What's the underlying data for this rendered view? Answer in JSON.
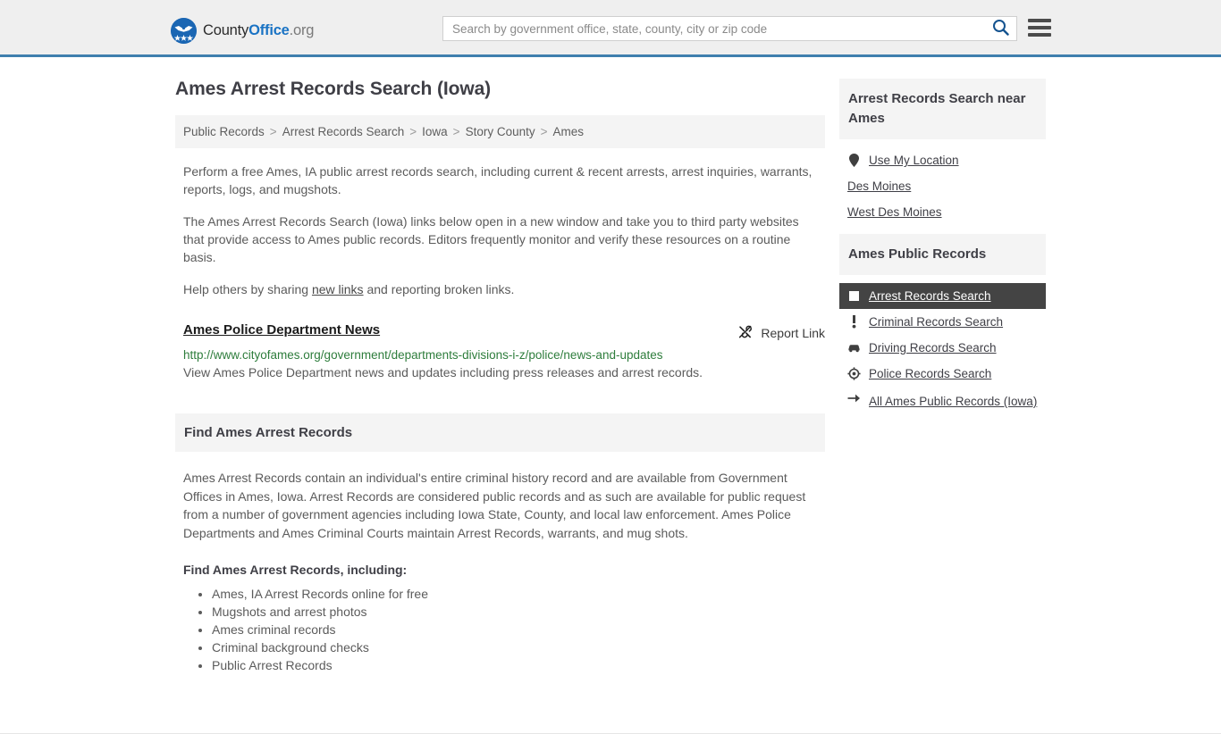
{
  "header": {
    "logo": {
      "part1": "County",
      "part2": "Office",
      "part3": ".org",
      "icon": "eagle-seal-logo"
    },
    "search": {
      "placeholder": "Search by government office, state, county, city or zip code",
      "value": "",
      "button_icon": "search-icon"
    },
    "menu_icon": "hamburger-menu-icon",
    "accent_color": "#3f7fae"
  },
  "main": {
    "title": "Ames Arrest Records Search (Iowa)",
    "breadcrumb": [
      "Public Records",
      "Arrest Records Search",
      "Iowa",
      "Story County",
      "Ames"
    ],
    "breadcrumb_separator": ">",
    "paragraphs": {
      "intro": "Perform a free Ames, IA public arrest records search, including current & recent arrests, arrest inquiries, warrants, reports, logs, and mugshots.",
      "disclaimer": "The Ames Arrest Records Search (Iowa) links below open in a new window and take you to third party websites that provide access to Ames public records. Editors frequently monitor and verify these resources on a routine basis.",
      "share_prefix": "Help others by sharing ",
      "share_link": "new links",
      "share_suffix": " and reporting broken links."
    },
    "result": {
      "title": "Ames Police Department News",
      "url": "http://www.cityofames.org/government/departments-divisions-i-z/police/news-and-updates",
      "description": "View Ames Police Department news and updates including press releases and arrest records.",
      "report_label": "Report Link",
      "report_icon": "broken-link-icon",
      "url_color": "#2e7d3c"
    },
    "section": {
      "heading": "Find Ames Arrest Records",
      "body": "Ames Arrest Records contain an individual's entire criminal history record and are available from Government Offices in Ames, Iowa. Arrest Records are considered public records and as such are available for public request from a number of government agencies including Iowa State, County, and local law enforcement. Ames Police Departments and Ames Criminal Courts maintain Arrest Records, warrants, and mug shots.",
      "list_heading": "Find Ames Arrest Records, including:",
      "list_items": [
        "Ames, IA Arrest Records online for free",
        "Mugshots and arrest photos",
        "Ames criminal records",
        "Criminal background checks",
        "Public Arrest Records"
      ]
    }
  },
  "sidebar": {
    "near_card": {
      "heading": "Arrest Records Search near Ames",
      "items": [
        {
          "label": "Use My Location",
          "icon": "map-pin-icon"
        },
        {
          "label": "Des Moines",
          "icon": "none"
        },
        {
          "label": "West Des Moines",
          "icon": "none"
        }
      ]
    },
    "records_card": {
      "heading": "Ames Public Records",
      "active_bg": "#444444",
      "items": [
        {
          "label": "Arrest Records Search",
          "icon": "white-square-icon",
          "active": true
        },
        {
          "label": "Criminal Records Search",
          "icon": "exclamation-icon",
          "active": false
        },
        {
          "label": "Driving Records Search",
          "icon": "car-icon",
          "active": false
        },
        {
          "label": "Police Records Search",
          "icon": "police-badge-icon",
          "active": false
        },
        {
          "label": "All Ames Public Records (Iowa)",
          "icon": "arrow-right-icon",
          "active": false
        }
      ]
    }
  }
}
